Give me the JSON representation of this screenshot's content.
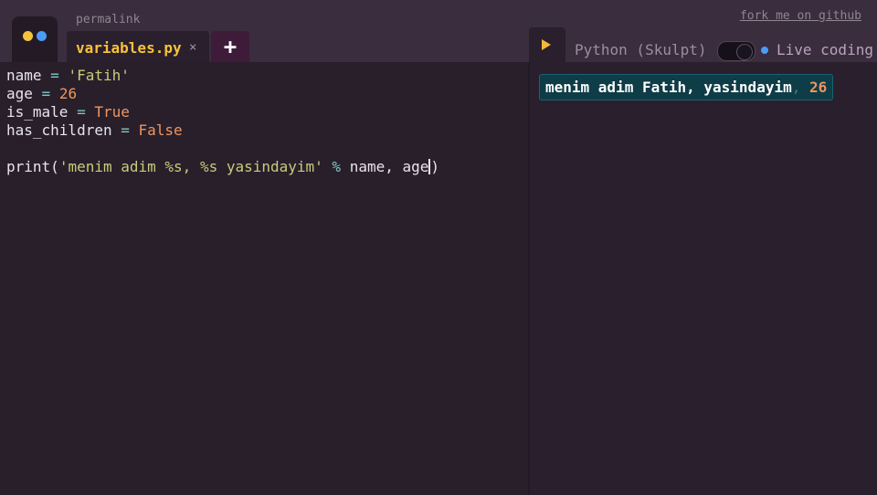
{
  "header": {
    "permalink_label": "permalink",
    "fork_label": "fork me on github",
    "tab": {
      "name": "variables.py",
      "close_glyph": "×"
    },
    "add_tab_glyph": "+",
    "engine_label": "Python (Skulpt)",
    "live_label": "Live coding",
    "live_toggle_on": true
  },
  "editor": {
    "lines": [
      [
        {
          "t": "name",
          "c": "plain"
        },
        {
          "t": " = ",
          "c": "op"
        },
        {
          "t": "'Fatih'",
          "c": "str"
        }
      ],
      [
        {
          "t": "age",
          "c": "plain"
        },
        {
          "t": " = ",
          "c": "op"
        },
        {
          "t": "26",
          "c": "num"
        }
      ],
      [
        {
          "t": "is_male",
          "c": "plain"
        },
        {
          "t": " = ",
          "c": "op"
        },
        {
          "t": "True",
          "c": "kw"
        }
      ],
      [
        {
          "t": "has_children",
          "c": "plain"
        },
        {
          "t": " = ",
          "c": "op"
        },
        {
          "t": "False",
          "c": "kw"
        }
      ],
      [],
      [
        {
          "t": "print",
          "c": "plain"
        },
        {
          "t": "(",
          "c": "plain"
        },
        {
          "t": "'menim adim %s, %s yasindayim'",
          "c": "str"
        },
        {
          "t": " % ",
          "c": "op"
        },
        {
          "t": "name, age",
          "c": "plain"
        },
        {
          "t": "|cursor",
          "c": "cursor"
        },
        {
          "t": ")",
          "c": "plain"
        }
      ]
    ]
  },
  "output": {
    "text": "menim adim Fatih, yasindayim",
    "separator": ",",
    "value": "26"
  },
  "colors": {
    "background": "#2a1f2d",
    "tab_accent": "#f7c23a",
    "string": "#c7cc7a",
    "number": "#f0955e",
    "operator": "#7fc8c6",
    "output_bg": "#0e3c47"
  }
}
